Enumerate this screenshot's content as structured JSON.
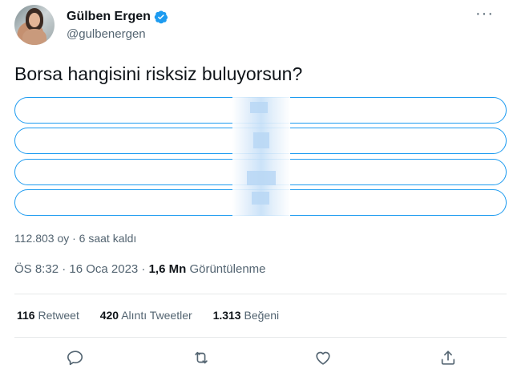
{
  "tweet": {
    "author_name": "Gülben Ergen",
    "author_handle": "@gulbenergen",
    "more_label": "···",
    "text": "Borsa hangisini risksiz buluyorsun?"
  },
  "poll": {
    "options": [
      "",
      "",
      "",
      ""
    ],
    "summary": "112.803 oy · 6 saat kaldı"
  },
  "meta": {
    "time_date": "ÖS 8:32 · 16 Oca 2023 · ",
    "views_count": "1,6 Mn",
    "views_label": " Görüntülenme"
  },
  "stats": {
    "retweets_count": "116",
    "retweets_label": " Retweet",
    "quotes_count": "420",
    "quotes_label": " Alıntı Tweetler",
    "likes_count": "1.313",
    "likes_label": " Beğeni"
  },
  "icons": {
    "verified": "verified-badge-icon",
    "reply": "reply-icon",
    "retweet": "retweet-icon",
    "like": "heart-icon",
    "share": "share-icon"
  },
  "colors": {
    "accent": "#1d9bf0",
    "text": "#0f1419",
    "secondary": "#536471",
    "divider": "#e7e9ea"
  }
}
